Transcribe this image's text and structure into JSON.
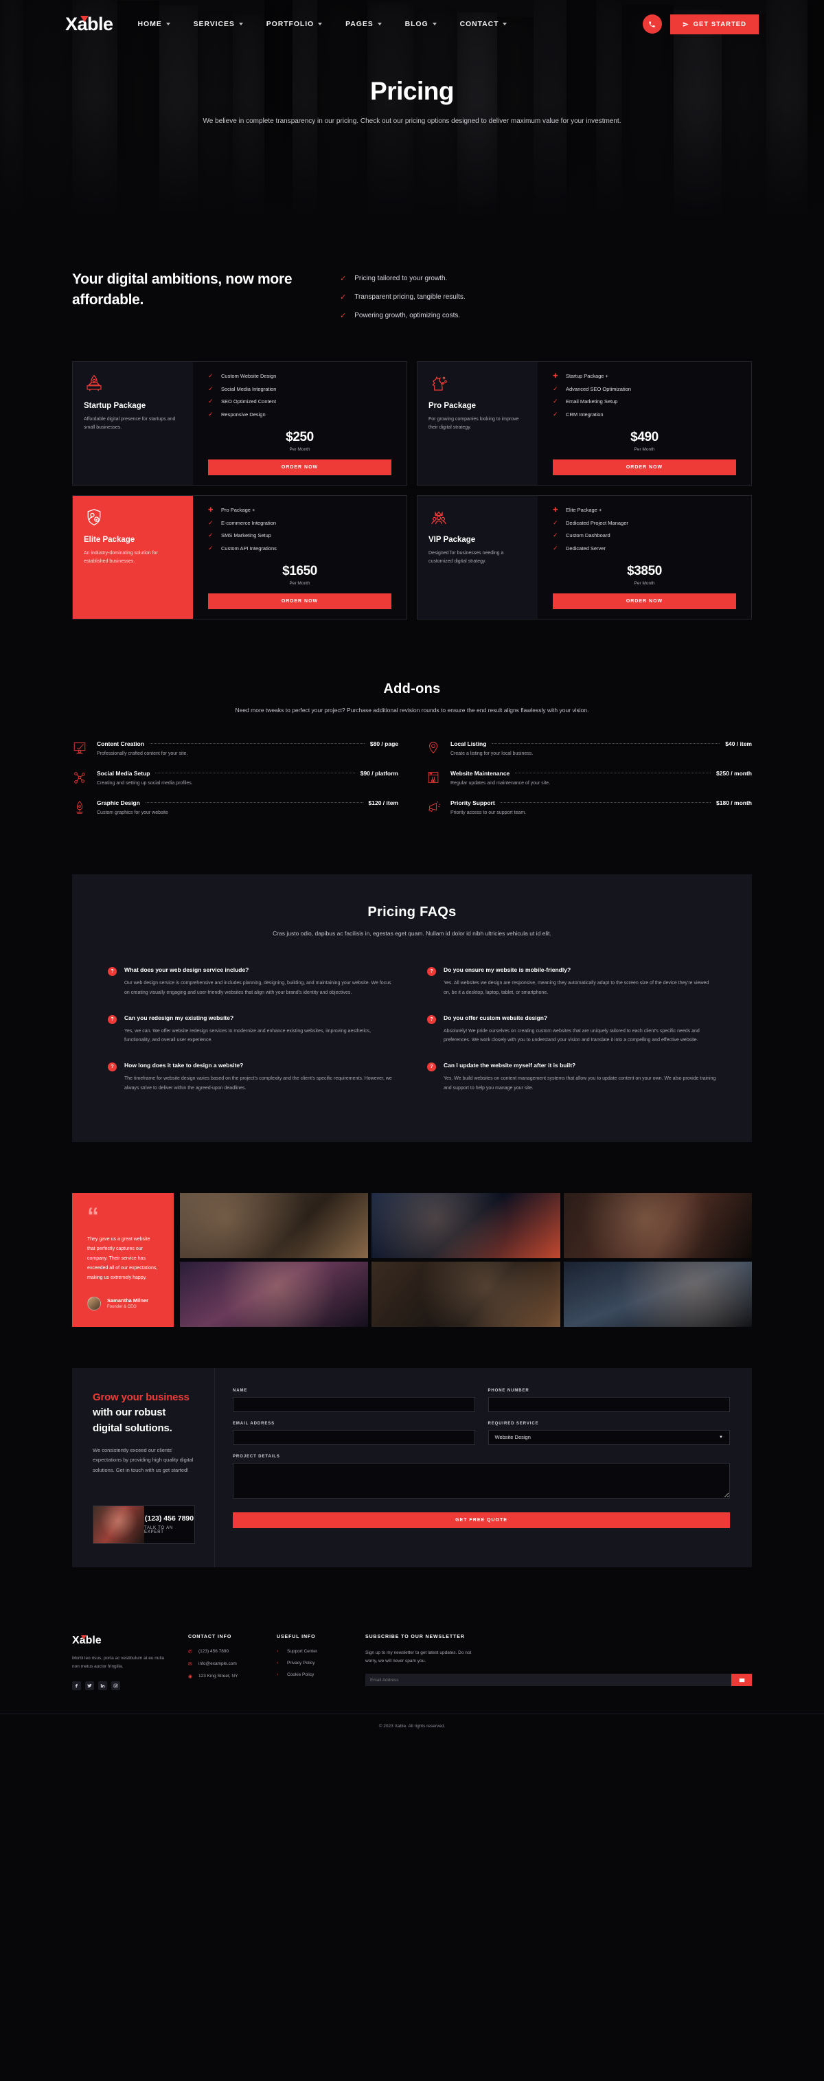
{
  "header": {
    "logo": "able",
    "logo_x": "X",
    "nav": [
      {
        "label": "HOME",
        "caret": true
      },
      {
        "label": "SERVICES",
        "caret": true
      },
      {
        "label": "PORTFOLIO",
        "caret": true
      },
      {
        "label": "PAGES",
        "caret": true
      },
      {
        "label": "BLOG",
        "caret": true
      },
      {
        "label": "CONTACT",
        "caret": true
      }
    ],
    "phone_icon": "phone-icon",
    "cta_label": "GET STARTED",
    "accent": "#ef3b38"
  },
  "hero": {
    "title": "Pricing",
    "subtitle": "We believe in complete transparency in our pricing. Check out our pricing options designed to deliver maximum value for your investment."
  },
  "ambitions": {
    "heading": "Your digital ambitions, now more affordable.",
    "points": [
      "Pricing tailored to your growth.",
      "Transparent pricing, tangible results.",
      "Powering growth, optimizing costs."
    ]
  },
  "packages": [
    {
      "icon": "rocket-icon",
      "name": "Startup Package",
      "description": "Affordable digital presence for startups and small businesses.",
      "highlight": false,
      "features": [
        {
          "mark": "check",
          "text": "Custom Website Design"
        },
        {
          "mark": "check",
          "text": "Social Media Integration"
        },
        {
          "mark": "check",
          "text": "SEO Optimized Content"
        },
        {
          "mark": "check",
          "text": "Responsive Design"
        }
      ],
      "price": "$250",
      "period": "Per Month",
      "button": "ORDER NOW"
    },
    {
      "icon": "chess-knight-icon",
      "name": "Pro Package",
      "description": "For growing companies looking to improve their digital strategy.",
      "highlight": false,
      "features": [
        {
          "mark": "plus",
          "text": "Startup Package +"
        },
        {
          "mark": "check",
          "text": "Advanced SEO Optimization"
        },
        {
          "mark": "check",
          "text": "Email Marketing Setup"
        },
        {
          "mark": "check",
          "text": "CRM Integration"
        }
      ],
      "price": "$490",
      "period": "Per Month",
      "button": "ORDER NOW"
    },
    {
      "icon": "shield-user-icon",
      "name": "Elite Package",
      "description": "An industry-dominating solution for established businesses.",
      "highlight": true,
      "features": [
        {
          "mark": "plus",
          "text": "Pro Package +"
        },
        {
          "mark": "check",
          "text": "E-commerce Integration"
        },
        {
          "mark": "check",
          "text": "SMS Marketing Setup"
        },
        {
          "mark": "check",
          "text": "Custom API Integrations"
        }
      ],
      "price": "$1650",
      "period": "Per Month",
      "button": "ORDER NOW"
    },
    {
      "icon": "crown-team-icon",
      "name": "VIP Package",
      "description": "Designed for businesses needing a customized digital strategy.",
      "highlight": false,
      "features": [
        {
          "mark": "plus",
          "text": "Elite Package +"
        },
        {
          "mark": "check",
          "text": "Dedicated Project Manager"
        },
        {
          "mark": "check",
          "text": "Custom Dashboard"
        },
        {
          "mark": "check",
          "text": "Dedicated Server"
        }
      ],
      "price": "$3850",
      "period": "Per Month",
      "button": "ORDER NOW"
    }
  ],
  "addons": {
    "title": "Add-ons",
    "subtitle": "Need more tweaks to perfect your project? Purchase additional revision rounds to ensure the end result aligns flawlessly with your vision.",
    "items": [
      {
        "icon": "content-monitor-icon",
        "name": "Content Creation",
        "price": "$80 / page",
        "desc": "Professionally crafted content for your site."
      },
      {
        "icon": "map-pin-icon",
        "name": "Local Listing",
        "price": "$40 / item",
        "desc": "Create a listing for your local business."
      },
      {
        "icon": "share-network-icon",
        "name": "Social Media Setup",
        "price": "$90 / platform",
        "desc": "Creating and setting up social media profiles."
      },
      {
        "icon": "browser-wrench-icon",
        "name": "Website Maintenance",
        "price": "$250 / month",
        "desc": "Regular updates and maintenance of your site."
      },
      {
        "icon": "pen-nib-icon",
        "name": "Graphic Design",
        "price": "$120 / item",
        "desc": "Custom graphics for your website"
      },
      {
        "icon": "megaphone-icon",
        "name": "Priority Support",
        "price": "$180 / month",
        "desc": "Priority access to our support team."
      }
    ]
  },
  "faq": {
    "title": "Pricing FAQs",
    "subtitle": "Cras justo odio, dapibus ac facilisis in, egestas eget quam. Nullam id dolor id nibh ultricies vehicula ut id elit.",
    "badge": "?",
    "items": [
      {
        "q": "What does your web design service include?",
        "a": "Our web design service is comprehensive and includes planning, designing, building, and maintaining your website. We focus on creating visually engaging and user-friendly websites that align with your brand's identity and objectives."
      },
      {
        "q": "Do you ensure my website is mobile-friendly?",
        "a": "Yes. All websites we design are responsive, meaning they automatically adapt to the screen size of the device they're viewed on, be it a desktop, laptop, tablet, or smartphone."
      },
      {
        "q": "Can you redesign my existing website?",
        "a": "Yes, we can. We offer website redesign services to modernize and enhance existing websites, improving aesthetics, functionality, and overall user experience."
      },
      {
        "q": "Do you offer custom website design?",
        "a": "Absolutely! We pride ourselves on creating custom websites that are uniquely tailored to each client's specific needs and preferences. We work closely with you to understand your vision and translate it into a compelling and effective website."
      },
      {
        "q": "How long does it take to design a website?",
        "a": "The timeframe for website design varies based on the project's complexity and the client's specific requirements. However, we always strive to deliver within the agreed-upon deadlines."
      },
      {
        "q": "Can I update the website myself after it is built?",
        "a": "Yes. We build websites on content management systems that allow you to update content on your own. We also provide training and support to help you manage your site."
      }
    ]
  },
  "testimonial": {
    "quote_mark": "“",
    "text": "They gave us a great website that perfectly captures our company. Their service has exceeded all of our expectations, making us extremely happy.",
    "name": "Samantha Milner",
    "role": "Founder & CEO"
  },
  "cta": {
    "heading_red": "Grow your business",
    "heading_rest": " with our robust digital solutions.",
    "paragraph": "We consistently exceed our clients' expectations by providing high quality digital solutions. Get in touch with us get started!",
    "phone": "(123) 456 7890",
    "phone_label": "TALK TO AN EXPERT",
    "form": {
      "name_label": "NAME",
      "name_value": "",
      "phone_label": "PHONE NUMBER",
      "phone_value": "",
      "email_label": "EMAIL ADDRESS",
      "email_value": "",
      "service_label": "REQUIRED SERVICE",
      "service_value": "Website Design",
      "details_label": "PROJECT DETAILS",
      "details_value": "",
      "submit": "GET FREE QUOTE"
    }
  },
  "footer": {
    "logo": "able",
    "logo_x": "X",
    "about": "Morbi leo risus, porta ac vestibulum at eu nulla non metus auctor fringilla.",
    "socials": [
      "facebook-icon",
      "twitter-icon",
      "linkedin-icon",
      "instagram-icon"
    ],
    "contact_title": "CONTACT INFO",
    "contact": [
      {
        "icon": "phone-icon",
        "text": "(123) 456 7890"
      },
      {
        "icon": "envelope-icon",
        "text": "info@example.com"
      },
      {
        "icon": "map-pin-icon",
        "text": "123 King Street, NY"
      }
    ],
    "useful_title": "USEFUL INFO",
    "useful": [
      "Support Center",
      "Privacy Policy",
      "Cookie Policy"
    ],
    "newsletter_title": "SUBSCRIBE TO OUR NEWSLETTER",
    "newsletter_sub": "Sign up to my newsletter to get latest updates. Do not worry, we will never spam you.",
    "newsletter_placeholder": "Email Address",
    "newsletter_button": "envelope-icon",
    "copyright": "© 2023 Xable. All rights reserved."
  }
}
